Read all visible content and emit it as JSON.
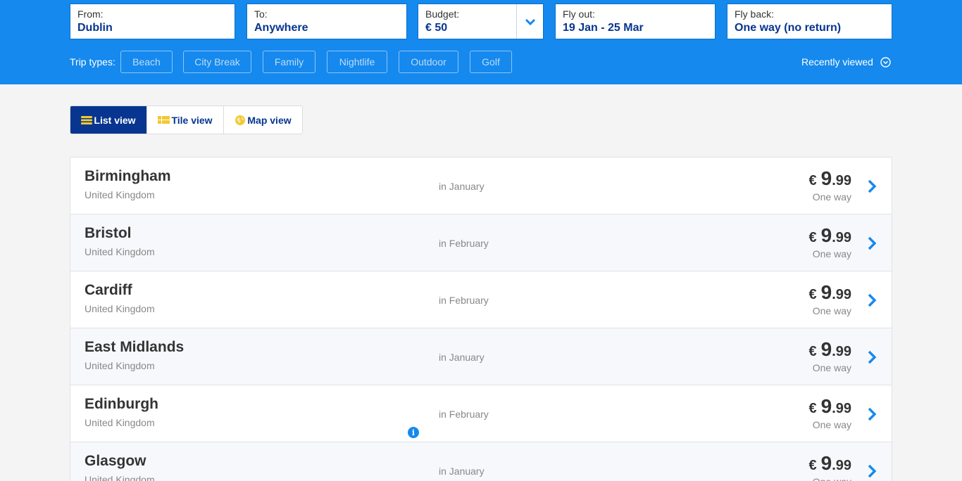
{
  "search": {
    "from_label": "From:",
    "from_value": "Dublin",
    "to_label": "To:",
    "to_value": "Anywhere",
    "budget_label": "Budget:",
    "budget_value": "€ 50",
    "flyout_label": "Fly out:",
    "flyout_value": "19 Jan - 25 Mar",
    "flyback_label": "Fly back:",
    "flyback_value": "One way (no return)"
  },
  "trip_types": {
    "label": "Trip types:",
    "chips": [
      "Beach",
      "City Break",
      "Family",
      "Nightlife",
      "Outdoor",
      "Golf"
    ]
  },
  "recently_viewed": "Recently viewed",
  "views": {
    "list": "List view",
    "tile": "Tile view",
    "map": "Map view",
    "active": "list"
  },
  "results": [
    {
      "city": "Birmingham",
      "country": "United Kingdom",
      "month": "in January",
      "currency": "€",
      "price_int": "9",
      "price_dec": ".99",
      "fare_type": "One way",
      "has_info": false
    },
    {
      "city": "Bristol",
      "country": "United Kingdom",
      "month": "in February",
      "currency": "€",
      "price_int": "9",
      "price_dec": ".99",
      "fare_type": "One way",
      "has_info": false
    },
    {
      "city": "Cardiff",
      "country": "United Kingdom",
      "month": "in February",
      "currency": "€",
      "price_int": "9",
      "price_dec": ".99",
      "fare_type": "One way",
      "has_info": false
    },
    {
      "city": "East Midlands",
      "country": "United Kingdom",
      "month": "in January",
      "currency": "€",
      "price_int": "9",
      "price_dec": ".99",
      "fare_type": "One way",
      "has_info": false
    },
    {
      "city": "Edinburgh",
      "country": "United Kingdom",
      "month": "in February",
      "currency": "€",
      "price_int": "9",
      "price_dec": ".99",
      "fare_type": "One way",
      "has_info": true
    },
    {
      "city": "Glasgow",
      "country": "United Kingdom",
      "month": "in January",
      "currency": "€",
      "price_int": "9",
      "price_dec": ".99",
      "fare_type": "One way",
      "has_info": false
    }
  ],
  "colors": {
    "header_blue": "#1589ee",
    "navy": "#073590",
    "accent_yellow": "#f1c933"
  },
  "icons": {
    "budget_toggle": "chevron-down-icon",
    "recently_viewed": "chevron-circle-down-icon",
    "list_view": "list-icon",
    "tile_view": "tile-icon",
    "map_view": "globe-icon",
    "info": "info-icon",
    "row_arrow": "chevron-right-icon"
  }
}
